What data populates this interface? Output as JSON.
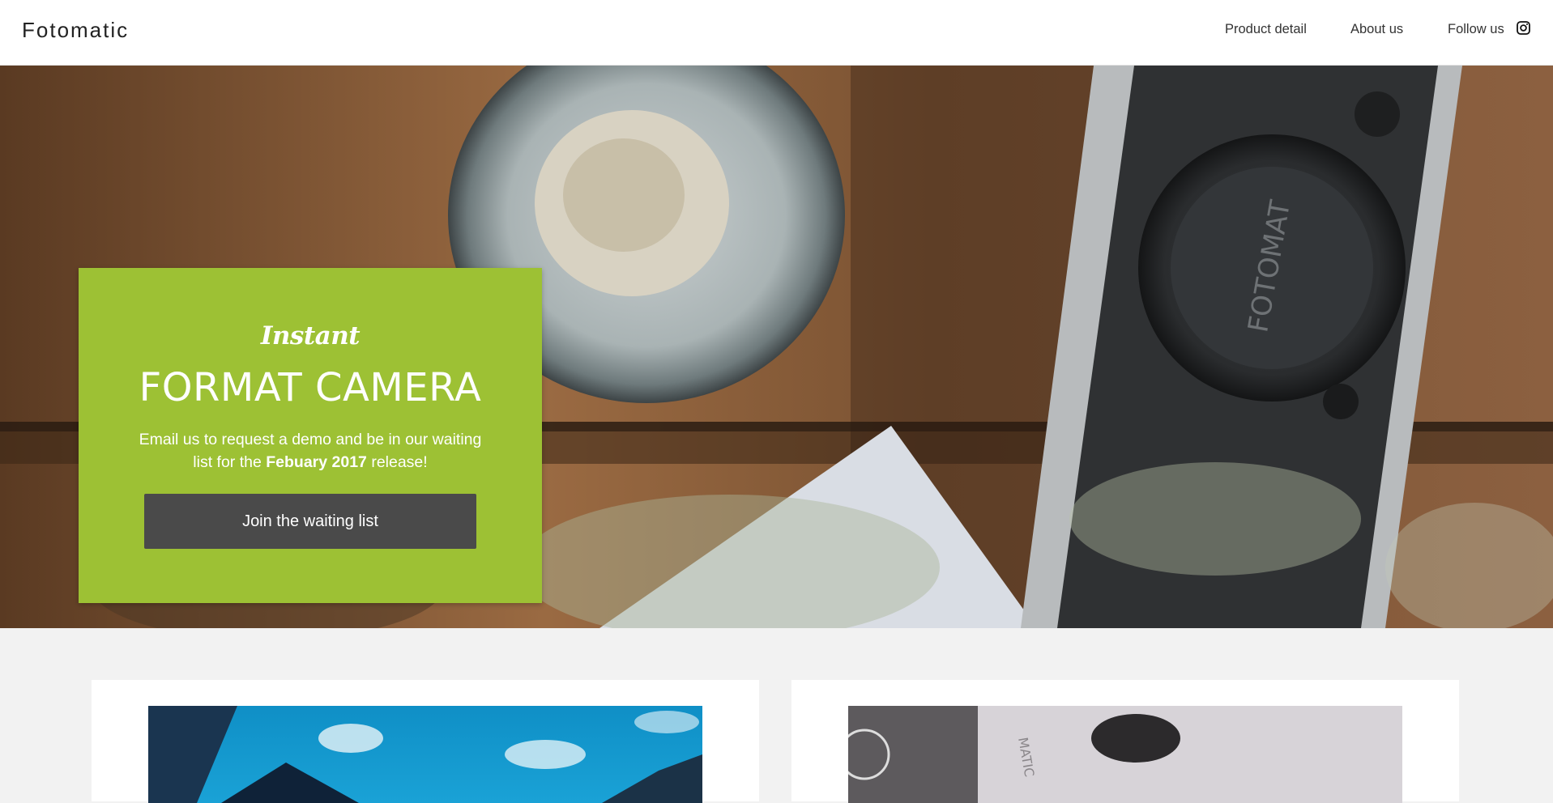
{
  "header": {
    "brand": "Fotomatic",
    "nav": {
      "product_detail": "Product detail",
      "about_us": "About us",
      "follow_us": "Follow us"
    },
    "social_icon": "instagram-icon"
  },
  "hero": {
    "image": "camera-on-wooden-table-photo",
    "promo": {
      "script_label": "Instant",
      "title": "FORMAT CAMERA",
      "description_prefix": "Email us to request a demo and be in our waiting list for the ",
      "description_bold": "Febuary 2017",
      "description_suffix": " release!",
      "cta_label": "Join the waiting list",
      "background_color": "#9dc134",
      "button_color": "#4a4a4a"
    }
  },
  "features": {
    "cards": [
      {
        "image": "blue-sky-landscape-photo"
      },
      {
        "image": "camera-closeup-photo"
      }
    ]
  }
}
